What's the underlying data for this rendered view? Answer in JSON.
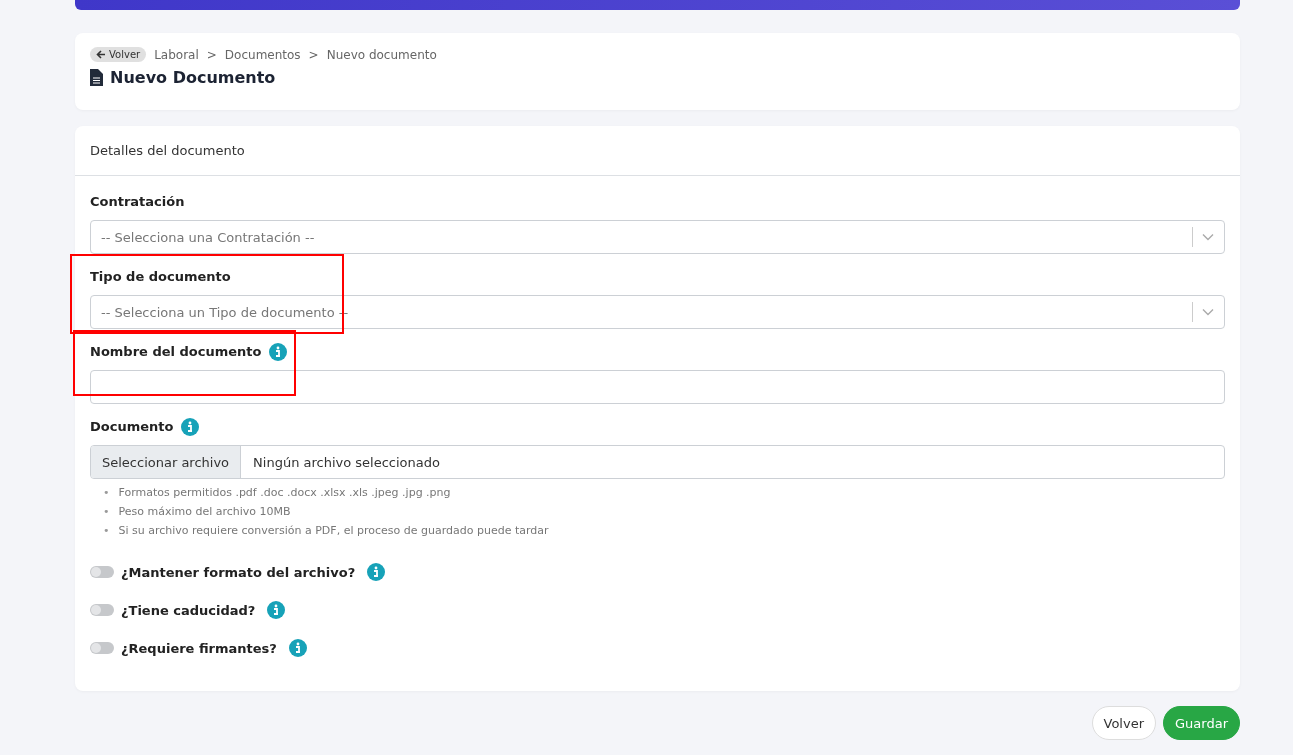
{
  "header": {
    "back_button": "Volver",
    "breadcrumbs": [
      "Laboral",
      "Documentos",
      "Nuevo documento"
    ],
    "separator": ">",
    "title": "Nuevo Documento"
  },
  "form": {
    "title": "Detalles del documento",
    "fields": [
      {
        "kind": "select",
        "label": "Contratación",
        "placeholder": "-- Selecciona una Contratación --",
        "info": false,
        "highlighted": false
      },
      {
        "kind": "select",
        "label": "Tipo de documento",
        "placeholder": "-- Selecciona un Tipo de documento --",
        "info": false,
        "highlighted": true
      },
      {
        "kind": "text",
        "label": "Nombre del documento",
        "info": true,
        "highlighted": true
      },
      {
        "kind": "file",
        "label": "Documento",
        "info": true,
        "highlighted": false,
        "button": "Seleccionar archivo",
        "value": "Ningún archivo seleccionado",
        "bullet": "•",
        "hints": [
          "Formatos permitidos .pdf .doc .docx .xlsx .xls .jpeg .jpg .png",
          "Peso máximo del archivo 10MB",
          "Si su archivo requiere conversión a PDF, el proceso de guardado puede tardar"
        ]
      }
    ],
    "switches": [
      {
        "label": "¿Mantener formato del archivo?",
        "on": false
      },
      {
        "label": "¿Tiene caducidad?",
        "on": false
      },
      {
        "label": "¿Requiere firmantes?",
        "on": false
      }
    ]
  },
  "buttons": [
    {
      "label": "Volver",
      "kind": "secondary"
    },
    {
      "label": "Guardar",
      "kind": "primary"
    }
  ]
}
